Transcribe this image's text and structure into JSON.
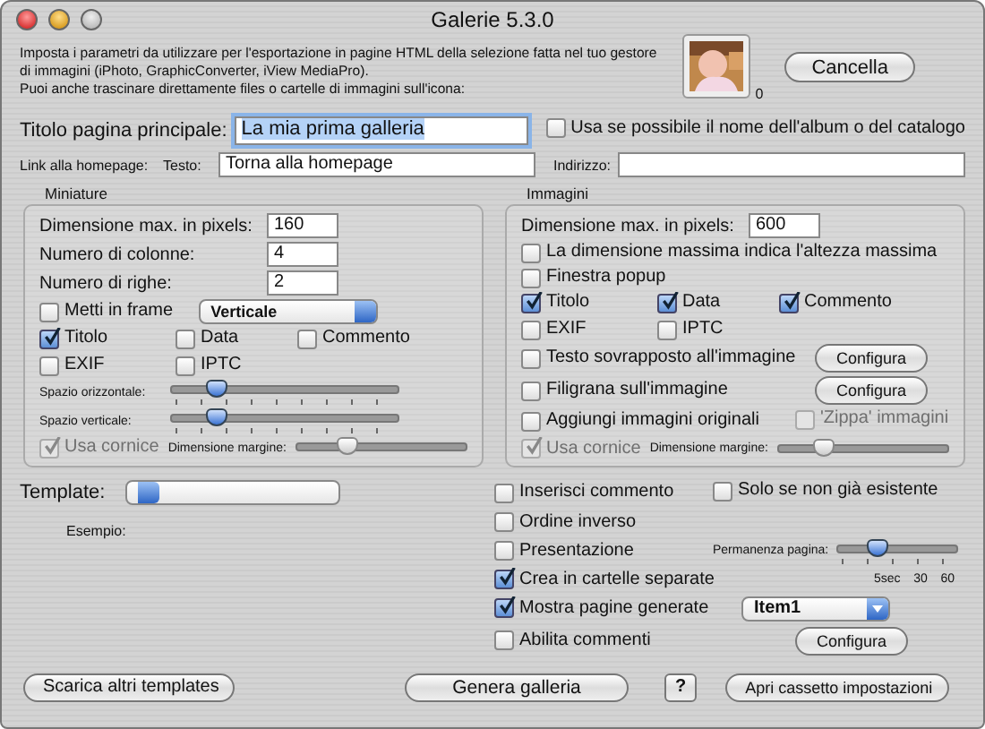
{
  "window": {
    "title": "Galerie 5.3.0"
  },
  "intro": [
    "Imposta i parametri da utilizzare per l'esportazione in pagine HTML della selezione fatta nel tuo gestore",
    "di immagini (iPhoto, GraphicConverter, iView MediaPro).",
    "Puoi anche trascinare direttamente files o cartelle di immagini sull'icona:"
  ],
  "drop_count": "0",
  "cancel_button": "Cancella",
  "main_title": {
    "label": "Titolo pagina principale:",
    "value": "La mia prima galleria"
  },
  "use_album_name": {
    "label": "Usa se possibile il nome dell'album o del catalogo",
    "checked": false
  },
  "homepage": {
    "label": "Link alla homepage:",
    "text_label": "Testo:",
    "text_value": "Torna alla homepage",
    "address_label": "Indirizzo:"
  },
  "thumbnails": {
    "title": "Miniature",
    "fields": [
      {
        "label": "Dimensione max. in pixels:",
        "value": "160"
      },
      {
        "label": "Numero di colonne:",
        "value": "4"
      },
      {
        "label": "Numero di righe:",
        "value": "2"
      }
    ],
    "frame": {
      "label": "Metti in frame",
      "checked": false,
      "select": "Verticale"
    },
    "checks": [
      {
        "label": "Titolo",
        "checked": true
      },
      {
        "label": "Data",
        "checked": false
      },
      {
        "label": "Commento",
        "checked": false
      },
      {
        "label": "EXIF",
        "checked": false
      },
      {
        "label": "IPTC",
        "checked": false
      }
    ],
    "sliders": [
      {
        "label": "Spazio orizzontale:",
        "level": 0.17
      },
      {
        "label": "Spazio verticale:",
        "level": 0.17
      }
    ],
    "border": {
      "label": "Usa cornice",
      "checked": true,
      "disabled": true
    },
    "margin": {
      "label": "Dimensione margine:",
      "level": 0.27
    }
  },
  "images": {
    "title": "Immagini",
    "size": {
      "label": "Dimensione max. in pixels:",
      "value": "600"
    },
    "max_height": {
      "label": "La dimensione massima indica l'altezza massima",
      "checked": false
    },
    "popup": {
      "label": "Finestra popup",
      "checked": false
    },
    "checks": [
      {
        "label": "Titolo",
        "checked": true
      },
      {
        "label": "Data",
        "checked": true
      },
      {
        "label": "Commento",
        "checked": true
      },
      {
        "label": "EXIF",
        "checked": false
      },
      {
        "label": "IPTC",
        "checked": false
      }
    ],
    "overlay_text": {
      "label": "Testo sovrapposto all'immagine",
      "checked": false,
      "button": "Configura"
    },
    "watermark": {
      "label": "Filigrana sull'immagine",
      "checked": false,
      "button": "Configura"
    },
    "originals": {
      "label": "Aggiungi immagini originali",
      "checked": false
    },
    "zip": {
      "label": "'Zippa' immagini",
      "checked": false,
      "disabled": true
    },
    "border": {
      "label": "Usa cornice",
      "checked": true,
      "disabled": true
    },
    "margin": {
      "label": "Dimensione margine:",
      "level": 0.24
    }
  },
  "template": {
    "label": "Template:",
    "example_label": "Esempio:"
  },
  "options": {
    "insert_comment": {
      "label": "Inserisci commento",
      "checked": false
    },
    "only_new": {
      "label": "Solo se non già esistente",
      "checked": false
    },
    "reverse": {
      "label": "Ordine inverso",
      "checked": false
    },
    "slideshow": {
      "label": "Presentazione",
      "checked": false
    },
    "page_duration": {
      "label": "Permanenza pagina:",
      "level": 0.3,
      "ticks": [
        "5sec",
        "30",
        "60"
      ]
    },
    "folders": {
      "label": "Crea in cartelle separate",
      "checked": true
    },
    "show_pages": {
      "label": "Mostra pagine generate",
      "checked": true
    },
    "app_select": "Item1",
    "comments": {
      "label": "Abilita commenti",
      "checked": false,
      "button": "Configura"
    }
  },
  "buttons": {
    "download": "Scarica altri templates",
    "generate": "Genera galleria",
    "help": "?",
    "drawer": "Apri cassetto impostazioni"
  }
}
